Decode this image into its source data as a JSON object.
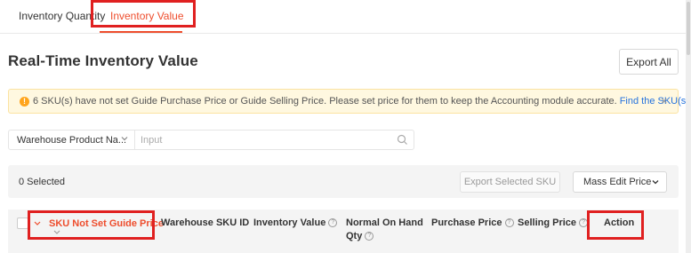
{
  "tabs": [
    {
      "label": "Inventory Quantity",
      "active": false
    },
    {
      "label": "Inventory Value",
      "active": true
    }
  ],
  "header": {
    "title": "Real-Time Inventory Value",
    "export_all_label": "Export All"
  },
  "notice": {
    "icon": "warning-icon",
    "message": "6 SKU(s) have not set Guide Purchase Price or Guide Selling Price. Please set price for them to keep the Accounting module accurate.",
    "link_label": "Find the SKU(s)",
    "close_glyph": "×"
  },
  "filter": {
    "field_selected": "Warehouse Product Na...",
    "input_placeholder": "Input",
    "input_value": ""
  },
  "selection": {
    "count_label": "0 Selected",
    "export_selected_label": "Export Selected SKU",
    "mass_edit_label": "Mass Edit Price"
  },
  "table": {
    "columns": {
      "sku_not_set": "SKU Not Set Guide Price",
      "warehouse_sku_id": "Warehouse SKU ID",
      "inventory_value": "Inventory Value",
      "normal_on_hand_line1": "Normal On Hand",
      "normal_on_hand_line2": "Qty",
      "purchase_price": "Purchase Price",
      "selling_price": "Selling Price",
      "action": "Action"
    }
  },
  "colors": {
    "accent": "#ee4d2d",
    "highlight_box": "#e02020",
    "link": "#2673dd",
    "notice_bg": "#fff8e0"
  }
}
